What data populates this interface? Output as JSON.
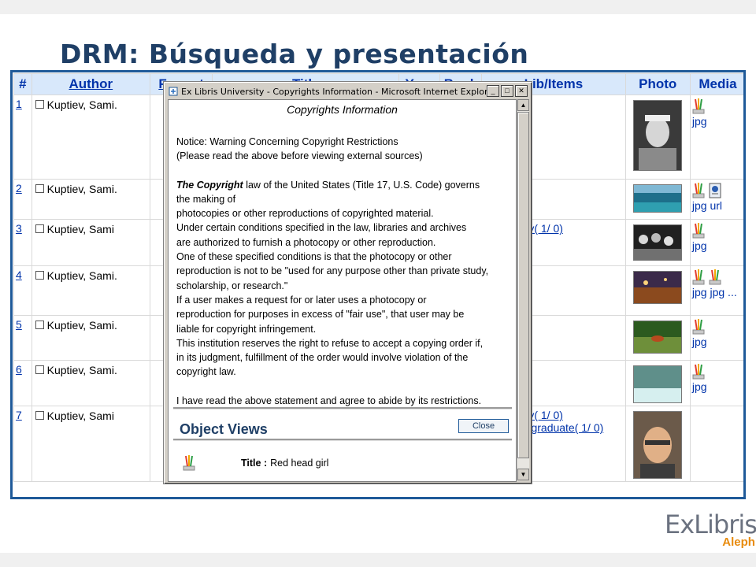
{
  "slide": {
    "title": "DRM: Búsqueda y presentación"
  },
  "table": {
    "headers": [
      {
        "key": "num",
        "label": "#"
      },
      {
        "key": "author",
        "label": "Author"
      },
      {
        "key": "format",
        "label": "Format"
      },
      {
        "key": "title",
        "label": "Title"
      },
      {
        "key": "year",
        "label": "Year"
      },
      {
        "key": "book",
        "label": "Book"
      },
      {
        "key": "lib",
        "label": "Lib/Items"
      },
      {
        "key": "photo",
        "label": "Photo"
      },
      {
        "key": "media",
        "label": "Media"
      }
    ],
    "rows": [
      {
        "num": "1",
        "author": "Kuptiev, Sami.",
        "lib": [],
        "media_icons": 1,
        "media_label": "jpg"
      },
      {
        "num": "2",
        "author": "Kuptiev, Sami.",
        "lib": [],
        "media_icons": 2,
        "media_label": "jpg url"
      },
      {
        "num": "3",
        "author": "Kuptiev, Sami",
        "lib": [
          "rary( 1/ 0)"
        ],
        "media_icons": 1,
        "media_label": "jpg"
      },
      {
        "num": "4",
        "author": "Kuptiev, Sami.",
        "lib": [],
        "media_icons": 2,
        "media_label": "jpg jpg ..."
      },
      {
        "num": "5",
        "author": "Kuptiev, Sami.",
        "lib": [],
        "media_icons": 1,
        "media_label": "jpg"
      },
      {
        "num": "6",
        "author": "Kuptiev, Sami.",
        "lib": [],
        "media_icons": 1,
        "media_label": "jpg"
      },
      {
        "num": "7",
        "author": "Kuptiev, Sami",
        "lib": [
          "rary( 1/ 0)",
          "dergraduate( 1/ 0)"
        ],
        "media_icons": 0,
        "media_label": ""
      }
    ]
  },
  "popup": {
    "window_title": "Ex Libris University - Copyrights Information - Microsoft Internet Explorer",
    "heading": "Copyrights Information",
    "notice_lines": [
      "Notice: Warning Concerning Copyright Restrictions",
      "(Please read the above before viewing external sources)"
    ],
    "copyright_label": "The Copyright",
    "copyright_first_rest": " law of the United States (Title 17, U.S. Code) governs",
    "body_lines": [
      "the making of",
      "photocopies or other reproductions of copyrighted material.",
      "Under certain conditions specified in the law, libraries and archives",
      "are authorized to furnish a photocopy or other reproduction.",
      "One of these specified conditions is that the photocopy or other",
      "reproduction is not to be \"used for any purpose other than private study,",
      "scholarship, or research.\"",
      "If a user makes a request for or later uses a photocopy or",
      "reproduction for purposes in excess of \"fair use\", that user may be",
      "liable for copyright infringement.",
      "This institution reserves the right to refuse to accept a copying order if,",
      "in its judgment, fulfillment of the order would involve violation of the",
      "copyright law."
    ],
    "agreement": "I have read the above statement and agree to abide by its restrictions.",
    "object_views_title": "Object Views",
    "close_label": "Close",
    "title_label": "Title :",
    "title_value": "Red head girl"
  },
  "logo": {
    "main": "ExLibris",
    "sub": "Aleph"
  },
  "colors": {
    "title": "#1f3f66",
    "frame": "#1f5a99",
    "header_bg": "#d8e8fb",
    "link": "#0033aa",
    "logo_accent": "#e88b0d"
  }
}
